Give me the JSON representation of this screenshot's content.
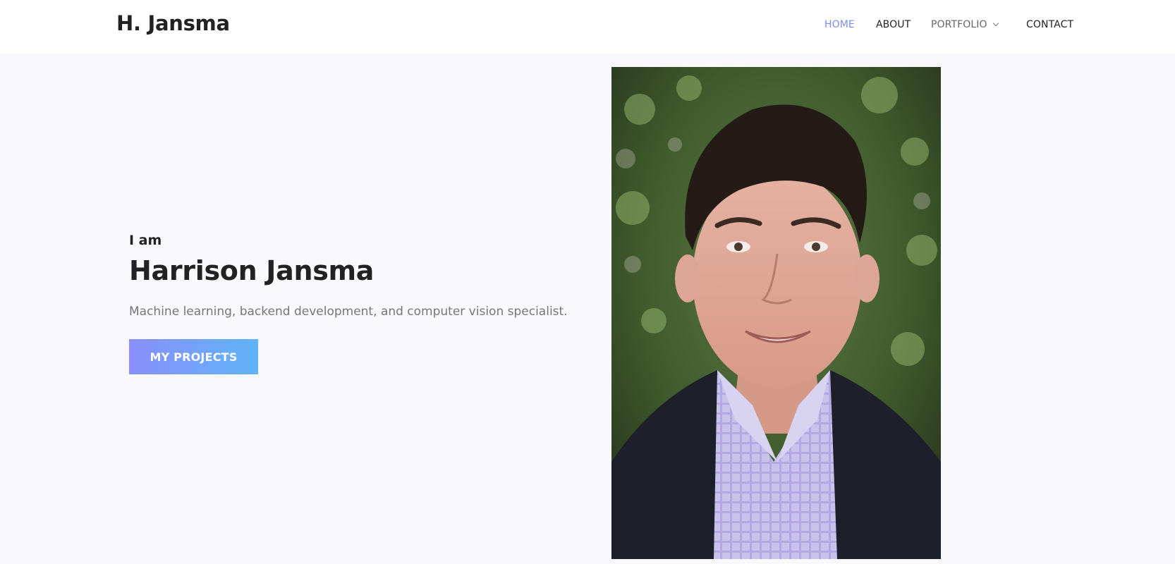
{
  "header": {
    "brand": "H. Jansma",
    "nav": [
      {
        "label": "HOME",
        "active": true
      },
      {
        "label": "ABOUT",
        "active": false
      },
      {
        "label": "PORTFOLIO",
        "active": false,
        "dropdown": true
      },
      {
        "label": "CONTACT",
        "active": false
      }
    ]
  },
  "hero": {
    "intro": "I am",
    "name": "Harrison Jansma",
    "tagline": "Machine learning, backend development, and computer vision specialist.",
    "cta_label": "MY PROJECTS"
  },
  "colors": {
    "accent": "#7c8ef8",
    "cta_gradient_start": "#8a8ffb",
    "cta_gradient_end": "#5fb4f8",
    "page_background": "#f8f8fd"
  },
  "icons": {
    "dropdown": "chevron-down-icon"
  }
}
